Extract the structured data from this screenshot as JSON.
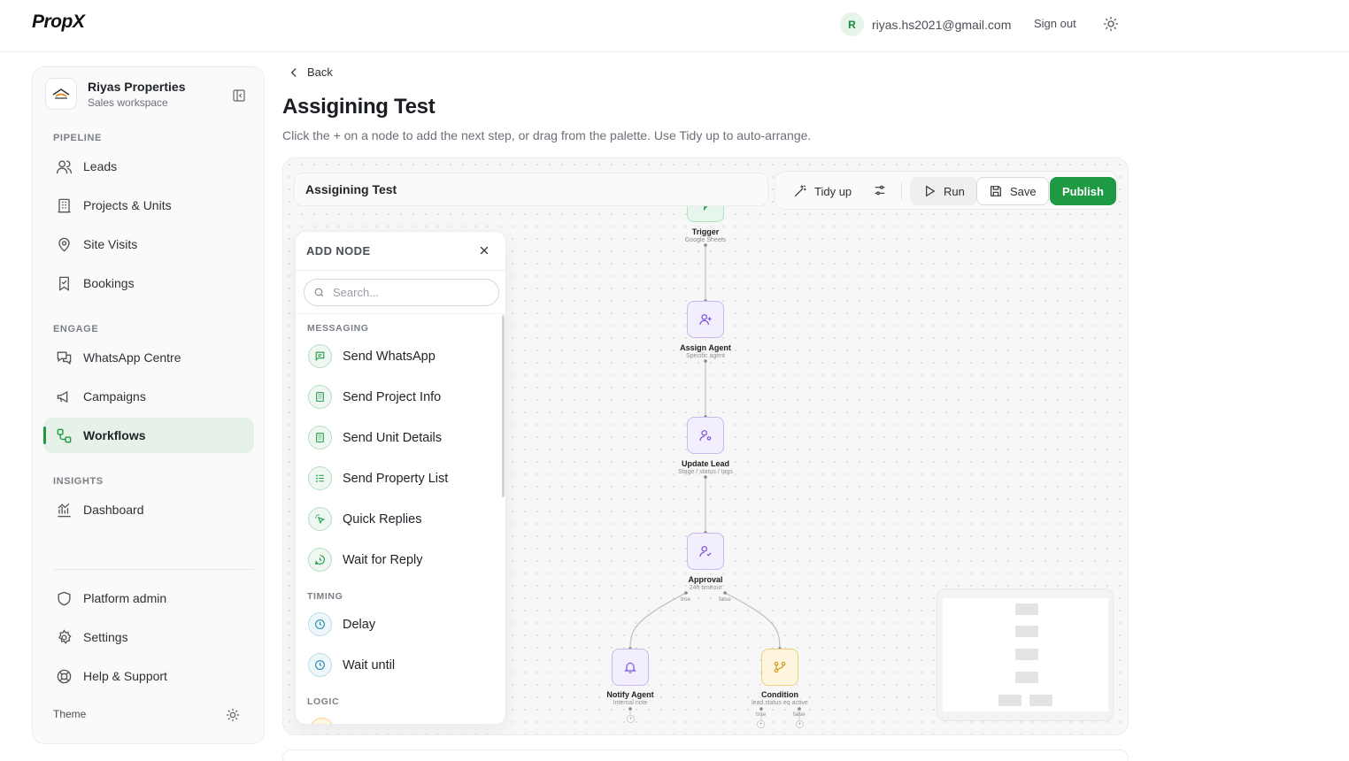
{
  "app": {
    "logo": "PropX"
  },
  "header": {
    "avatar_initial": "R",
    "user_email": "riyas.hs2021@gmail.com",
    "signout_label": "Sign out",
    "theme_icon": "sun-icon"
  },
  "sidebar": {
    "workspace_name": "Riyas Properties",
    "workspace_sub": "Sales workspace",
    "sections": {
      "pipeline": "PIPELINE",
      "engage": "ENGAGE",
      "insights": "INSIGHTS"
    },
    "items": {
      "leads": "Leads",
      "projects": "Projects & Units",
      "site_visits": "Site Visits",
      "bookings": "Bookings",
      "whatsapp": "WhatsApp Centre",
      "campaigns": "Campaigns",
      "workflows": "Workflows",
      "dashboard": "Dashboard",
      "platform_admin": "Platform admin",
      "settings": "Settings",
      "help": "Help & Support"
    },
    "active_item": "Workflows",
    "theme_label": "Theme"
  },
  "main": {
    "back_label": "Back",
    "title": "Assigining Test",
    "subtitle": "Click the + on a node to add the next step, or drag from the palette. Use Tidy up to auto-arrange."
  },
  "editor": {
    "workflow_name": "Assigining Test",
    "toolbar": {
      "tidy_up": "Tidy up",
      "run": "Run",
      "save": "Save",
      "publish": "Publish"
    },
    "colors": {
      "accent": "#1e9a44",
      "node_purple": "#c9b8f1",
      "node_yellow": "#efcf7f"
    }
  },
  "palette": {
    "title": "ADD NODE",
    "search_placeholder": "Search...",
    "categories": {
      "messaging": "MESSAGING",
      "timing": "TIMING",
      "logic": "LOGIC"
    },
    "messaging_items": [
      "Send WhatsApp",
      "Send Project Info",
      "Send Unit Details",
      "Send Property List",
      "Quick Replies",
      "Wait for Reply"
    ],
    "timing_items": [
      "Delay",
      "Wait until"
    ]
  },
  "flow": {
    "nodes": {
      "trigger": {
        "label": "Trigger",
        "sub": "Google Sheets"
      },
      "assign": {
        "label": "Assign Agent",
        "sub": "Specific agent"
      },
      "update": {
        "label": "Update Lead",
        "sub": "Stage / status / tags"
      },
      "approval": {
        "label": "Approval",
        "sub": "24h timeout",
        "port_true": "true",
        "port_false": "false"
      },
      "notify": {
        "label": "Notify Agent",
        "sub": "Internal note"
      },
      "condition": {
        "label": "Condition",
        "sub": "lead.status eq active",
        "port_true": "true",
        "port_false": "false"
      }
    },
    "add_symbol": "+"
  }
}
